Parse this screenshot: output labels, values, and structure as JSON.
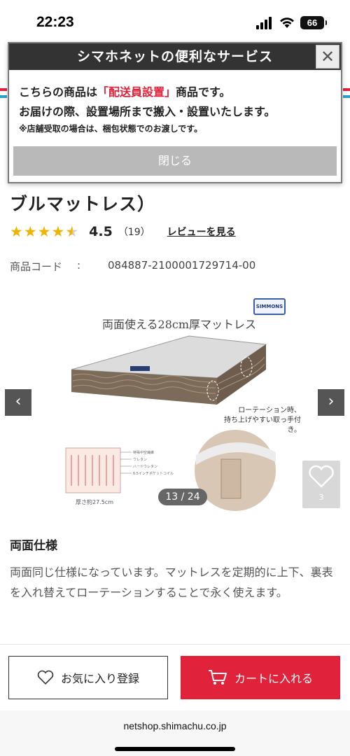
{
  "status_bar": {
    "time": "22:23",
    "battery": "66"
  },
  "product": {
    "title_fragment": "ブルマットレス）",
    "rating": 4.5,
    "rating_text": "4.5",
    "review_count": "（19）",
    "review_link": "レビューを見る",
    "code_label": "商品コード",
    "code_separator": ":",
    "code_value": "084887-2100001729714-00"
  },
  "gallery": {
    "headline": "両面使える28cm厚マットレス",
    "brand": "SIMMONS",
    "caption_line1": "ローテーション時、",
    "caption_line2": "持ち上げやすい取っ手付き。",
    "thickness_label": "厚さ約27.5cm",
    "counter": "13 / 24",
    "favorite_count": "3",
    "prev_glyph": "‹",
    "next_glyph": "›"
  },
  "spec": {
    "heading": "両面仕様",
    "body": "両面同じ仕様になっています。マットレスを定期的に上下、裏表を入れ替えてローテーションすることで永く使えます。"
  },
  "actions": {
    "favorite_label": "お気に入り登録",
    "cart_label": "カートに入れる"
  },
  "browser": {
    "url": "netshop.shimachu.co.jp"
  },
  "modal": {
    "title": "シマホネットの便利なサービス",
    "close_glyph": "✕",
    "line1_prefix": "こちらの商品は",
    "line1_accent": "「配送員設置」",
    "line1_suffix": "商品です。",
    "line2": "お届けの際、設置場所まで搬入・設置いたします。",
    "note": "※店舗受取の場合は、梱包状態でのお渡しです。",
    "button": "閉じる"
  },
  "colors": {
    "accent_red": "#e0223a",
    "star": "#f0b400",
    "modal_header": "#333333"
  }
}
